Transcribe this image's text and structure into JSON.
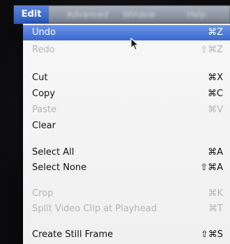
{
  "menubar": {
    "active_menu": "Edit",
    "other_menus": [
      "Advanced",
      "Window",
      "Help"
    ]
  },
  "edit_menu": {
    "items": [
      {
        "label": "Undo",
        "shortcut": "⌘Z",
        "enabled": true,
        "highlighted": true
      },
      {
        "label": "Redo",
        "shortcut": "⇧⌘Z",
        "enabled": false
      },
      {
        "label": "Cut",
        "shortcut": "⌘X",
        "enabled": true
      },
      {
        "label": "Copy",
        "shortcut": "⌘C",
        "enabled": true
      },
      {
        "label": "Paste",
        "shortcut": "⌘V",
        "enabled": false
      },
      {
        "label": "Clear",
        "shortcut": "",
        "enabled": true
      },
      {
        "label": "Select All",
        "shortcut": "⌘A",
        "enabled": true
      },
      {
        "label": "Select None",
        "shortcut": "⇧⌘A",
        "enabled": true
      },
      {
        "label": "Crop",
        "shortcut": "⌘K",
        "enabled": false
      },
      {
        "label": "Split Video Clip at Playhead",
        "shortcut": "⌘T",
        "enabled": false
      },
      {
        "label": "Create Still Frame",
        "shortcut": "⇧⌘S",
        "enabled": true
      }
    ]
  },
  "colors": {
    "highlight": "#3a69d2",
    "menu_background": "#f4f4f4",
    "disabled_text": "#b4b4b4"
  }
}
